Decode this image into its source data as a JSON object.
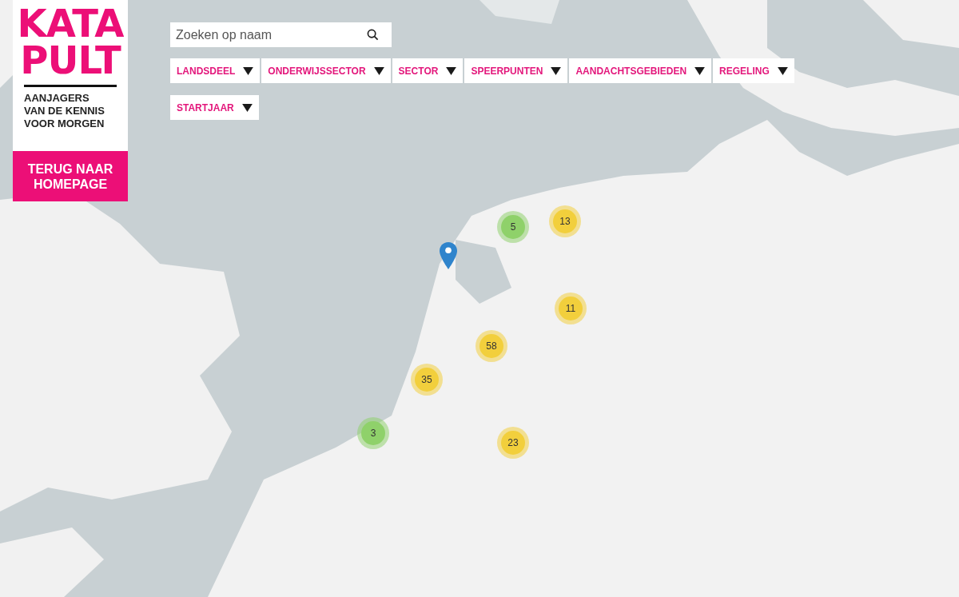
{
  "logo": {
    "lines": [
      "KATA",
      "PULT"
    ],
    "tagline": [
      "AANJAGERS",
      "VAN DE KENNIS",
      "VOOR MORGEN"
    ],
    "button": "TERUG NAAR HOMEPAGE"
  },
  "search": {
    "placeholder": "Zoeken op naam"
  },
  "filters": [
    {
      "label": "LANDSDEEL"
    },
    {
      "label": "ONDERWIJSSECTOR"
    },
    {
      "label": "SECTOR"
    },
    {
      "label": "SPEERPUNTEN"
    },
    {
      "label": "AANDACHTSGEBIEDEN"
    },
    {
      "label": "REGELING"
    },
    {
      "label": "STARTJAAR"
    }
  ],
  "clusters": [
    {
      "count": "5",
      "color": "#8fd16a"
    },
    {
      "count": "13",
      "color": "#f2cf3c"
    },
    {
      "count": "11",
      "color": "#f2cf3c"
    },
    {
      "count": "58",
      "color": "#f2cf3c"
    },
    {
      "count": "35",
      "color": "#f2cf3c"
    },
    {
      "count": "3",
      "color": "#8fd16a"
    },
    {
      "count": "23",
      "color": "#f2cf3c"
    }
  ],
  "pins": [
    {
      "kind": "marker"
    }
  ]
}
